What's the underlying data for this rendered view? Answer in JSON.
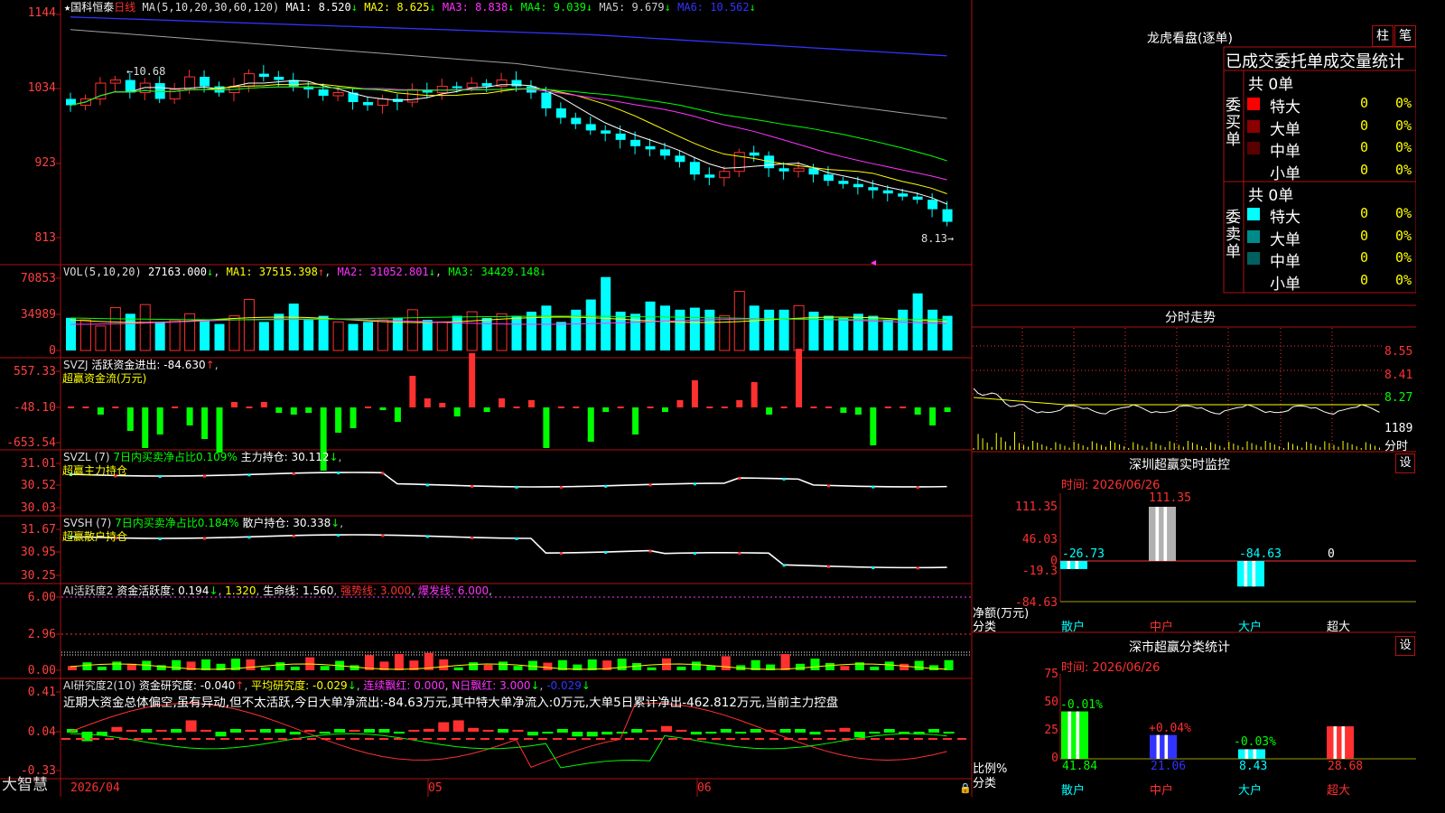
{
  "colors": {
    "up": "#ff3030",
    "down": "#00ffff",
    "red": "#ff3030",
    "cyan": "#00ffff",
    "white": "#ffffff",
    "yellow": "#ffff00",
    "magenta": "#ff33ff",
    "green": "#00ff00",
    "blue": "#3333ff",
    "gray": "#a0a0a0",
    "frame": "#b01010"
  },
  "title": {
    "star": "★",
    "name": "国科恒泰",
    "period": "日线"
  },
  "main_panel": {
    "ma_header": "MA(5,10,20,30,60,120)",
    "ma": [
      {
        "label": "MA1:",
        "value": "8.520",
        "arrow": "↓"
      },
      {
        "label": "MA2:",
        "value": "8.625",
        "arrow": "↓"
      },
      {
        "label": "MA3:",
        "value": "8.838",
        "arrow": "↓"
      },
      {
        "label": "MA4:",
        "value": "9.039",
        "arrow": "↓"
      },
      {
        "label": "MA5:",
        "value": "9.679",
        "arrow": "↓"
      },
      {
        "label": "MA6:",
        "value": "10.562",
        "arrow": "↓"
      }
    ],
    "y_ticks": [
      "1144",
      "1034",
      "923",
      "813"
    ],
    "high_label": "←10.68",
    "low_label": "8.13→"
  },
  "vol_panel": {
    "header": "VOL(5,10,20)",
    "value": "27163.000",
    "arrow": "↓",
    "ma": [
      {
        "label": "MA1:",
        "value": "37515.398",
        "arrow": "↑"
      },
      {
        "label": "MA2:",
        "value": "31052.801",
        "arrow": "↓"
      },
      {
        "label": "MA3:",
        "value": "34429.148",
        "arrow": "↓"
      }
    ],
    "y_ticks": [
      "70853",
      "34989",
      "0"
    ]
  },
  "svzj_panel": {
    "header": "SVZJ",
    "label1": "活跃资金进出:",
    "value1": "-84.630",
    "arrow1": "↑",
    "subtitle": "超赢资金流(万元)",
    "y_ticks": [
      "557.33",
      "-48.10",
      "-653.54"
    ]
  },
  "svzl_panel": {
    "header": "SVZL (7)",
    "label1": "7日内买卖净占比0.109%",
    "label2": "主力持仓:",
    "value2": "30.112",
    "arrow2": "↓",
    "subtitle": "超赢主力持仓",
    "y_ticks": [
      "31.01",
      "30.52",
      "30.03"
    ]
  },
  "svsh_panel": {
    "header": "SVSH (7)",
    "label1": "7日内买卖净占比0.184%",
    "label2": "散户持仓:",
    "value2": "30.338",
    "arrow2": "↓",
    "subtitle": "超赢散户持仓",
    "y_ticks": [
      "31.67",
      "30.95",
      "30.25"
    ]
  },
  "ai_active_panel": {
    "header": "AI活跃度2",
    "label1": "资金活跃度:",
    "value1": "0.194",
    "arrow1": "↓",
    "value1b": "1.320",
    "label2": "生命线:",
    "value2": "1.560",
    "label3": "强势线:",
    "value3": "3.000",
    "label4": "爆发线:",
    "value4": "6.000",
    "y_ticks": [
      "6.00",
      "2.96",
      "0.00"
    ]
  },
  "ai_research_panel": {
    "header": "AI研究度2(10)",
    "label1": "资金研究度:",
    "value1": "-0.040",
    "arrow1": "↑",
    "label2": "平均研究度:",
    "value2": "-0.029",
    "arrow2": "↓",
    "label3": "连续飘红:",
    "value3": "0.000",
    "label4": "N日飘红:",
    "value4": "3.000",
    "arrow4": "↓",
    "value5": "-0.029",
    "arrow5": "↓",
    "comment": "近期大资金总体偏空,虽有异动,但不太活跃,今日大单净流出:-84.63万元,其中特大单净流入:0万元,大单5日累计净出-462.812万元,当前主力控盘",
    "y_ticks": [
      "0.41",
      "0.04",
      "-0.33"
    ]
  },
  "bottom_bar": {
    "brand": "大智慧",
    "dates": [
      "2026/04",
      "05",
      "06"
    ]
  },
  "dragon_tiger": {
    "title": "龙虎看盘(逐单)",
    "btn_bar": "柱",
    "btn_detail": "笔",
    "subtitle": "已成交委托单成交量统计",
    "buy": {
      "side_label": "委买单",
      "total": "共 0单",
      "rows": [
        {
          "name": "特大",
          "count": "0",
          "pct": "0%",
          "color": "#ff0000"
        },
        {
          "name": "大单",
          "count": "0",
          "pct": "0%",
          "color": "#8b0000"
        },
        {
          "name": "中单",
          "count": "0",
          "pct": "0%",
          "color": "#5a0000"
        },
        {
          "name": "小单",
          "count": "0",
          "pct": "0%",
          "color": "#000000"
        }
      ]
    },
    "sell": {
      "side_label": "委卖单",
      "total": "共 0单",
      "rows": [
        {
          "name": "特大",
          "count": "0",
          "pct": "0%",
          "color": "#00ffff"
        },
        {
          "name": "大单",
          "count": "0",
          "pct": "0%",
          "color": "#008b8b"
        },
        {
          "name": "中单",
          "count": "0",
          "pct": "0%",
          "color": "#006060"
        },
        {
          "name": "小单",
          "count": "0",
          "pct": "0%",
          "color": "#000000"
        }
      ]
    }
  },
  "intraday": {
    "title": "分时走势",
    "y_ticks": [
      "8.55",
      "8.41",
      "8.27"
    ],
    "vol_label": "1189",
    "vol_unit": "分时"
  },
  "sz_monitor": {
    "title": "深圳超赢实时监控",
    "settings": "设",
    "date_label": "时间: 2026/06/26",
    "y_ticks": [
      "111.35",
      "46.03",
      "0",
      "-19.3",
      "-84.63"
    ],
    "axis_title": "净额(万元)",
    "axis_sub": "分类",
    "bars": [
      {
        "cat": "散户",
        "value": -26.73,
        "label": "-26.73"
      },
      {
        "cat": "中户",
        "value": 111.35,
        "label": "111.35"
      },
      {
        "cat": "大户",
        "value": -84.63,
        "label": "-84.63"
      },
      {
        "cat": "超大",
        "value": 0,
        "label": "0"
      }
    ]
  },
  "sz_class": {
    "title": "深市超赢分类统计",
    "settings": "设",
    "date_label": "时间: 2026/06/26",
    "y_ticks": [
      "75",
      "50",
      "25",
      "0"
    ],
    "axis_title": "比例%",
    "axis_sub": "分类",
    "bars": [
      {
        "cat": "散户",
        "value": 41.84,
        "label": "41.84",
        "change": "-0.01%"
      },
      {
        "cat": "中户",
        "value": 21.06,
        "label": "21.06",
        "change": "+0.04%"
      },
      {
        "cat": "大户",
        "value": 8.43,
        "label": "8.43",
        "change": "-0.03%"
      },
      {
        "cat": "超大",
        "value": 28.68,
        "label": "28.68",
        "change": ""
      }
    ]
  }
}
